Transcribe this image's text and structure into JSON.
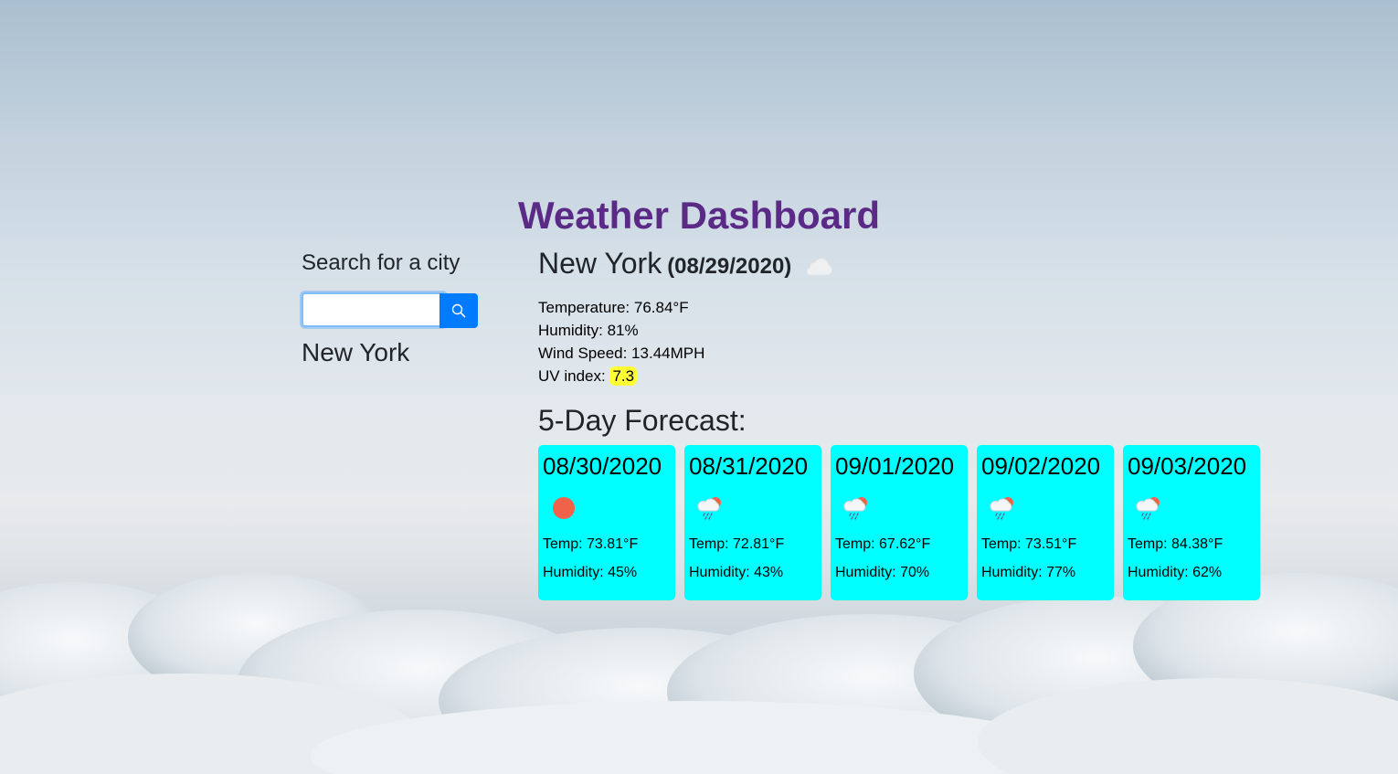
{
  "app": {
    "title": "Weather Dashboard"
  },
  "search": {
    "label": "Search for a city",
    "input_value": "",
    "placeholder": "",
    "button_icon": "search-icon"
  },
  "history": {
    "cities": [
      "New York"
    ]
  },
  "current": {
    "city": "New York",
    "date": "(08/29/2020)",
    "icon": "cloud-icon",
    "temperature": "Temperature: 76.84°F",
    "humidity": "Humidity: 81%",
    "wind": "Wind Speed: 13.44MPH",
    "uv_label": "UV index: ",
    "uv_value": "7.3",
    "uv_color": "#ffff33"
  },
  "forecast": {
    "title": "5-Day Forecast:",
    "card_color": "#00ffff",
    "days": [
      {
        "date": "08/30/2020",
        "icon": "sun-icon",
        "temp": "Temp: 73.81°F",
        "humidity": "Humidity: 45%"
      },
      {
        "date": "08/31/2020",
        "icon": "sun-rain-cloud-icon",
        "temp": "Temp: 72.81°F",
        "humidity": "Humidity: 43%"
      },
      {
        "date": "09/01/2020",
        "icon": "sun-rain-cloud-icon",
        "temp": "Temp: 67.62°F",
        "humidity": "Humidity: 70%"
      },
      {
        "date": "09/02/2020",
        "icon": "sun-rain-cloud-icon",
        "temp": "Temp: 73.51°F",
        "humidity": "Humidity: 77%"
      },
      {
        "date": "09/03/2020",
        "icon": "sun-rain-cloud-icon",
        "temp": "Temp: 84.38°F",
        "humidity": "Humidity: 62%"
      }
    ]
  },
  "colors": {
    "title": "#5b2a86",
    "button": "#007bff"
  }
}
